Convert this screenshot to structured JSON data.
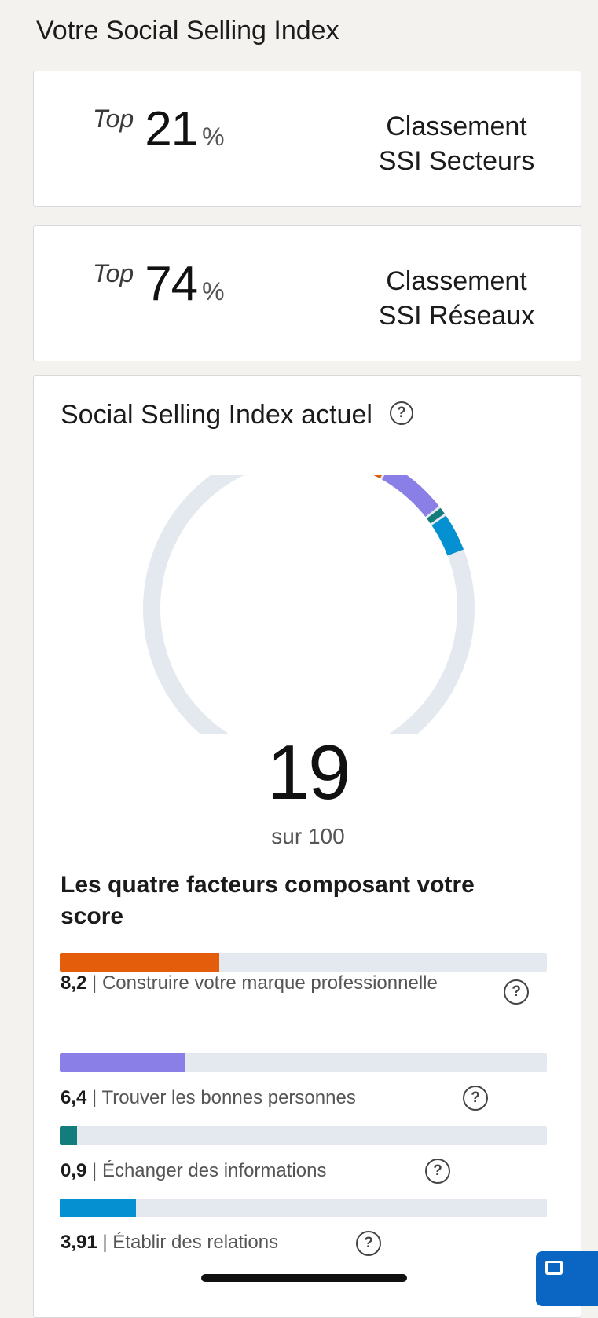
{
  "page": {
    "title": "Votre Social Selling Index"
  },
  "rankings": [
    {
      "top_word": "Top",
      "value": "21",
      "percent": "%",
      "label_line1": "Classement",
      "label_line2": "SSI Secteurs"
    },
    {
      "top_word": "Top",
      "value": "74",
      "percent": "%",
      "label_line1": "Classement",
      "label_line2": "SSI Réseaux"
    }
  ],
  "ssi": {
    "title": "Social Selling Index actuel",
    "help_glyph": "?",
    "score": "19",
    "score_suffix": "sur 100",
    "score_max": 100,
    "factors_heading": "Les quatre facteurs composant votre score",
    "factor_max": 25,
    "factors": [
      {
        "value": "8,2",
        "score": 8.2,
        "label": "Construire votre marque professionnelle",
        "color": "#e35d0b",
        "icon": "help-icon"
      },
      {
        "value": "6,4",
        "score": 6.4,
        "label": "Trouver les bonnes personnes",
        "color": "#8a7fe6",
        "icon": "help-icon"
      },
      {
        "value": "0,9",
        "score": 0.9,
        "label": "Échanger des informations",
        "color": "#137d7c",
        "icon": "help-icon"
      },
      {
        "value": "3,91",
        "score": 3.91,
        "label": "Établir des relations",
        "color": "#0591d1",
        "icon": "help-icon"
      }
    ],
    "track_color": "#e4e9f0"
  }
}
